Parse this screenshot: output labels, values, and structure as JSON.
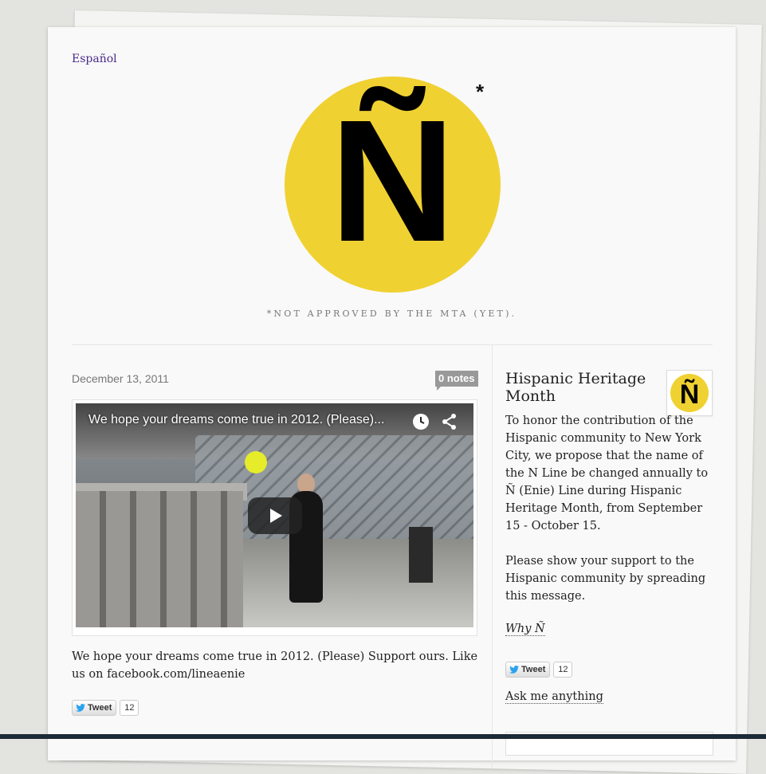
{
  "header": {
    "language_link": "Español",
    "logo_letter": "Ñ",
    "logo_asterisk": "*",
    "tagline": "*NOT APPROVED BY THE MTA (YET)."
  },
  "post": {
    "date": "December 13, 2011",
    "notes": "0 notes",
    "video_title": "We hope your dreams come true in 2012. (Please)...",
    "caption": "We hope your dreams come true in 2012. (Please) Support ours. Like us on facebook.com/lineaenie",
    "tweet_label": "Tweet",
    "tweet_count": "12"
  },
  "sidebar": {
    "title": "Hispanic Heritage Month",
    "avatar_letter": "Ñ",
    "description": [
      "To honor the contribution of the Hispanic community to New York City, we propose that the name of the N Line be changed annually to Ñ (Enie) Line during Hispanic Heritage Month, from September 15 - October 15.",
      "Please show your support to the Hispanic community by spreading this message."
    ],
    "why_link": "Why Ñ",
    "tweet_label": "Tweet",
    "tweet_count": "12",
    "ask_link": "Ask me anything"
  },
  "colors": {
    "logo_yellow": "#f0d132",
    "link_purple": "#4b2a8a",
    "notes_gray": "#999999"
  }
}
